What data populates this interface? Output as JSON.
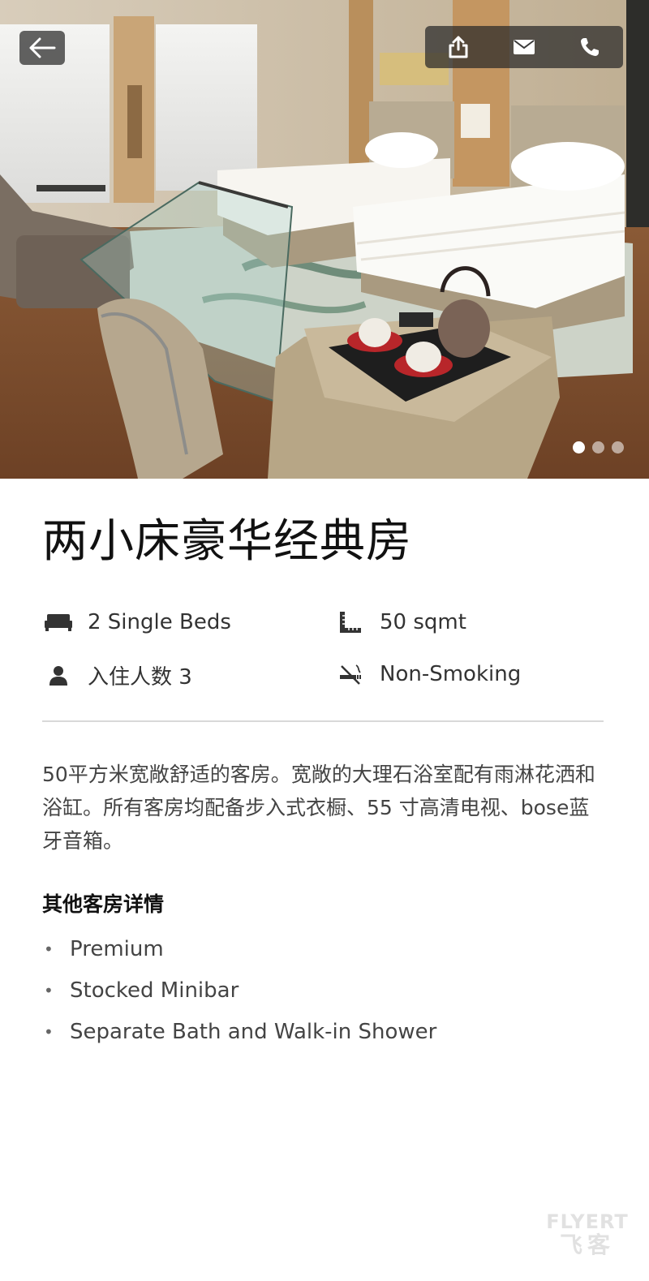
{
  "room": {
    "title": "两小床豪华经典房",
    "features": {
      "beds": "2 Single Beds",
      "size": "50 sqmt",
      "occupancy": "入住人数 3",
      "smoking": "Non-Smoking"
    },
    "description": "50平方米宽敞舒适的客房。宽敞的大理石浴室配有雨淋花洒和浴缸。所有客房均配备步入式衣橱、55 寸高清电视、bose蓝牙音箱。",
    "details_heading": "其他客房详情",
    "details": [
      "Premium",
      "Stocked Minibar",
      "Separate Bath and Walk-in Shower"
    ]
  },
  "gallery": {
    "photo_count": 3,
    "active_index": 0
  },
  "icons": {
    "back": "arrow-left-icon",
    "share": "share-icon",
    "email": "envelope-icon",
    "phone": "phone-icon",
    "bed": "bed-icon",
    "ruler": "ruler-icon",
    "person": "person-icon",
    "no_smoking": "no-smoking-icon"
  },
  "watermark": {
    "line1": "FLYERT",
    "line2": "飞客"
  },
  "colors": {
    "overlay_button": "#282828",
    "divider": "#d9d9d9",
    "text_primary": "#111111",
    "text_secondary": "#444444"
  }
}
